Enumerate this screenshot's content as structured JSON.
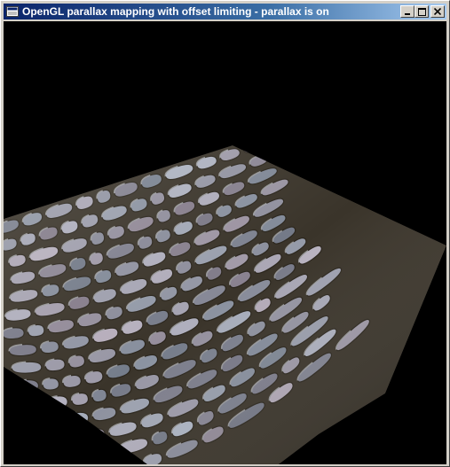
{
  "window": {
    "title": "OpenGL parallax mapping with offset limiting - parallax is on",
    "app_icon": "window-app-icon",
    "buttons": {
      "minimize": "minimize-icon",
      "maximize": "maximize-icon",
      "close": "close-icon"
    }
  },
  "scene": {
    "background_color": "#000000",
    "surface": "cobblestone-parallax-plane",
    "stone_color": "#8a94a0",
    "grout_color": "#3a342a"
  }
}
